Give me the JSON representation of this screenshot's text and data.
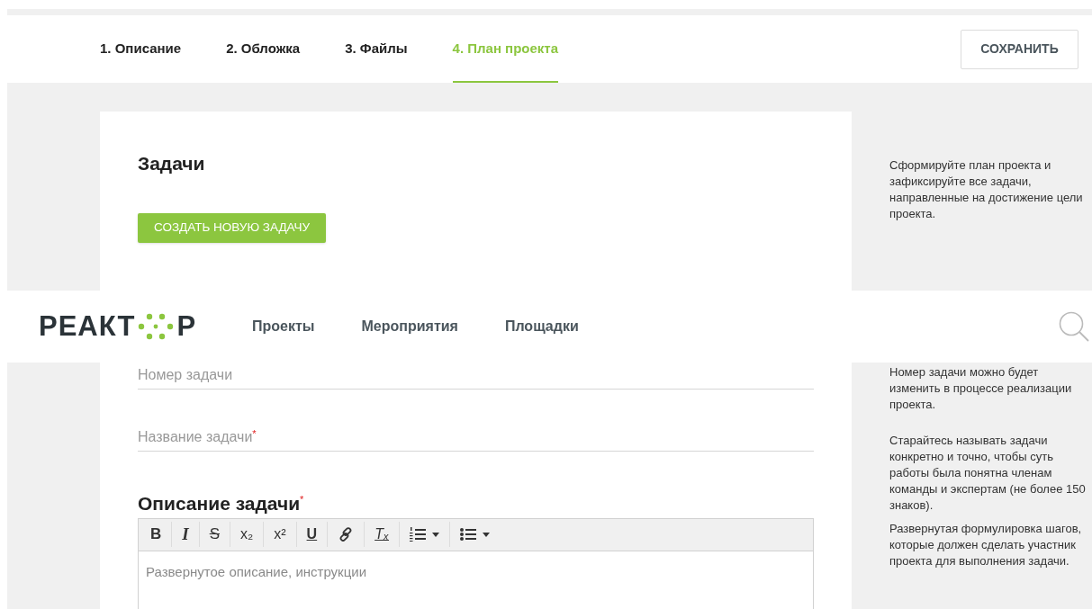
{
  "steps": [
    {
      "label": "1. Описание",
      "selected": false
    },
    {
      "label": "2. Обложка",
      "selected": false
    },
    {
      "label": "3. Файлы",
      "selected": false
    },
    {
      "label": "4. План проекта",
      "selected": true
    }
  ],
  "save_button": "СОХРАНИТЬ",
  "section_title": "Задачи",
  "create_button": "СОЗДАТЬ НОВУЮ ЗАДАЧУ",
  "required_mark": "*",
  "fields": [
    {
      "placeholder": "Номер задачи",
      "required": false
    },
    {
      "placeholder": "Название задачи",
      "required": true
    }
  ],
  "description": {
    "title": "Описание задачи",
    "required": true,
    "placeholder": "Развернутое описание, инструкции",
    "toolbar": [
      {
        "kind": "bold",
        "label": "B"
      },
      {
        "kind": "italic",
        "label": "I"
      },
      {
        "kind": "strike",
        "label": "S"
      },
      {
        "kind": "subscript",
        "label": "x₂"
      },
      {
        "kind": "superscript",
        "label": "x²"
      },
      {
        "kind": "underline",
        "label": "U"
      },
      {
        "kind": "link"
      },
      {
        "kind": "clear",
        "label": "Tₓ"
      },
      {
        "kind": "ordered-list"
      },
      {
        "kind": "bullet-list"
      }
    ]
  },
  "hints": [
    "Сформируйте план проекта и зафиксируйте все задачи, направленные на достижение цели проекта.",
    "Номер задачи можно будет изменить в процессе реализации проекта.",
    "Старайтесь называть задачи конкретно и точно, чтобы суть работы была понятна членам команды и экспертам (не более 150 знаков).",
    "Развернутая формулировка шагов, которые должен сделать участник проекта для выполнения задачи."
  ],
  "header": {
    "logo_left": "РЕАКТ",
    "logo_right": "Р",
    "nav": [
      "Проекты",
      "Мероприятия",
      "Площадки"
    ]
  }
}
